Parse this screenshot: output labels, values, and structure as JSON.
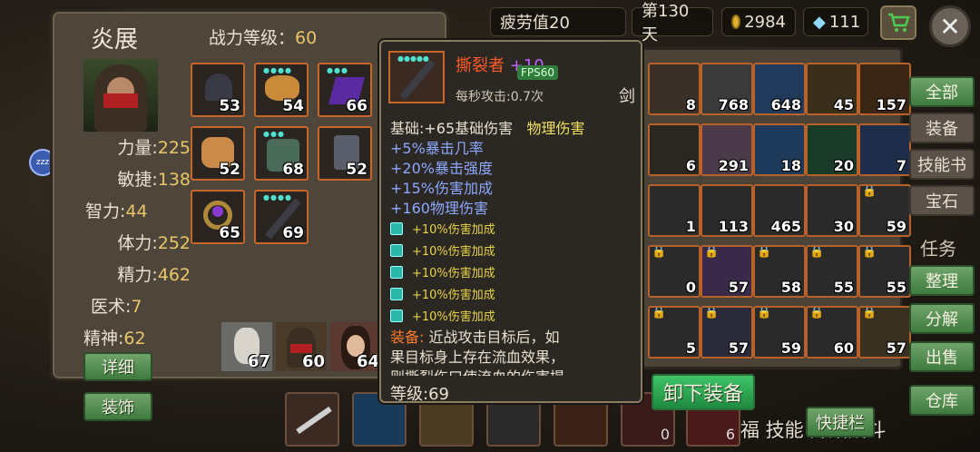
{
  "topbar": {
    "fatigue_label": "疲劳值20",
    "day_label": "第130天",
    "gold": "2984",
    "diamonds": "111",
    "close_symbol": "✕"
  },
  "character": {
    "name": "炎展",
    "power_label": "战力等级：",
    "power_value": "60",
    "stats": [
      {
        "label": "力量:",
        "value": "225"
      },
      {
        "label": "敏捷:",
        "value": "138"
      },
      {
        "label": "智力:",
        "value": "44"
      },
      {
        "label": "体力:",
        "value": "252"
      },
      {
        "label": "精力:",
        "value": "462"
      },
      {
        "label": "医术:",
        "value": "7"
      },
      {
        "label": "精神:",
        "value": "62"
      }
    ],
    "detail_button": "详细",
    "decor_button": "装饰",
    "zzz": "zzz",
    "equipment": [
      "53",
      "54",
      "66",
      "52",
      "68",
      "52",
      "65",
      "69"
    ],
    "party": [
      "67",
      "60",
      "64"
    ]
  },
  "tooltip": {
    "item_name": "撕裂者",
    "item_plus": "+10",
    "fps": "FPS60",
    "attack_speed": "每秒攻击:0.7次",
    "weapon_type": "剑",
    "base": "基础:+65基础伤害",
    "damage_type": "物理伤害",
    "stats": [
      "+5%暴击几率",
      "+20%暴击强度",
      "+15%伤害加成",
      "+160物理伤害"
    ],
    "affixes": [
      "+10%伤害加成",
      "+10%伤害加成",
      "+10%伤害加成",
      "+10%伤害加成",
      "+10%伤害加成"
    ],
    "equip_label": "装备:",
    "equip_text_1": "近战攻击目标后，如",
    "equip_text_2": "果目标身上存在流血效果，",
    "equip_text_3": "则撕裂伤口使流血的伤害提",
    "level": "等级:69"
  },
  "unequip_button": "卸下装备",
  "inventory": {
    "counts": [
      "8",
      "768",
      "648",
      "45",
      "157",
      "6",
      "291",
      "18",
      "20",
      "7",
      "1",
      "113",
      "465",
      "30",
      "59",
      "0",
      "57",
      "58",
      "55",
      "55",
      "5",
      "57",
      "59",
      "60",
      "57"
    ]
  },
  "filters": {
    "all": "全部",
    "equipment": "装备",
    "skillbook": "技能书",
    "gem": "宝石",
    "task": "任务",
    "sort": "整理",
    "decompose": "分解",
    "sell": "出售",
    "warehouse": "仓库"
  },
  "bottom": {
    "hotbar_button": "快捷栏",
    "bottom_text": "福 技能 开始战斗",
    "skill_counts": [
      "0",
      "6"
    ]
  },
  "colors": {
    "accent_gold": "#e9c66a",
    "item_name_red": "#ff5a2a",
    "plus_purple": "#c060ff",
    "stat_blue": "#8da8ff",
    "affix_yellow": "#e7d34a"
  }
}
